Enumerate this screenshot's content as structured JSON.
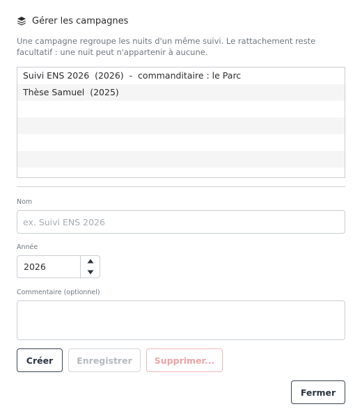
{
  "header": {
    "title": "Gérer les campagnes",
    "icon": "layers-icon"
  },
  "description": "Une campagne regroupe les nuits d'un même suivi. Le rattachement reste facultatif : une nuit peut n'appartenir à aucune.",
  "campaigns": [
    "Suivi ENS 2026  (2026)  -  commanditaire : le Parc",
    "Thèse Samuel  (2025)"
  ],
  "form": {
    "nom_label": "Nom",
    "nom_placeholder": "ex. Suivi ENS 2026",
    "annee_label": "Année",
    "annee_value": "2026",
    "commentaire_label": "Commentaire (optionnel)"
  },
  "buttons": {
    "create": "Créer",
    "save": "Enregistrer",
    "delete": "Supprimer...",
    "close": "Fermer"
  }
}
